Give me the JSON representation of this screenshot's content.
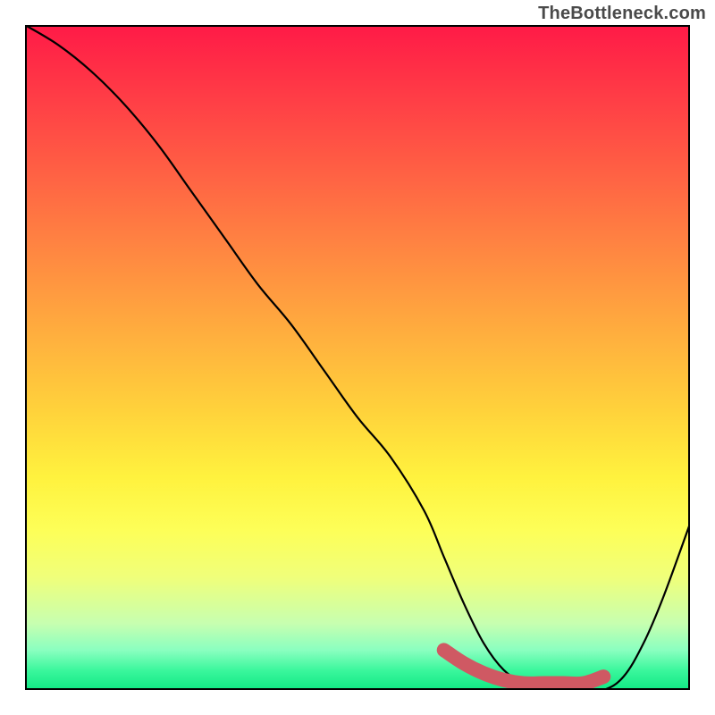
{
  "watermark": "TheBottleneck.com",
  "chart_data": {
    "type": "line",
    "title": "",
    "xlabel": "",
    "ylabel": "",
    "xlim": [
      0,
      100
    ],
    "ylim": [
      0,
      100
    ],
    "series": [
      {
        "name": "bottleneck-curve",
        "x": [
          0,
          5,
          10,
          15,
          20,
          25,
          30,
          35,
          40,
          45,
          50,
          55,
          60,
          63,
          66,
          69,
          72,
          75,
          78,
          81,
          84,
          87,
          90,
          93,
          96,
          100
        ],
        "y": [
          100,
          97,
          93,
          88,
          82,
          75,
          68,
          61,
          55,
          48,
          41,
          35,
          27,
          20,
          13,
          7,
          3,
          1,
          0,
          0,
          0,
          0,
          2,
          7,
          14,
          25
        ]
      },
      {
        "name": "optimal-zone-marker",
        "x": [
          63,
          66,
          69,
          72,
          75,
          78,
          81,
          84,
          87
        ],
        "y": [
          6,
          4,
          2.5,
          1.5,
          1,
          1,
          1,
          1,
          2
        ]
      }
    ],
    "colors": {
      "curve": "#000000",
      "marker": "#cf5963"
    },
    "marker_style": "thick-rounded-line",
    "background": "vertical-heatmap-gradient"
  }
}
